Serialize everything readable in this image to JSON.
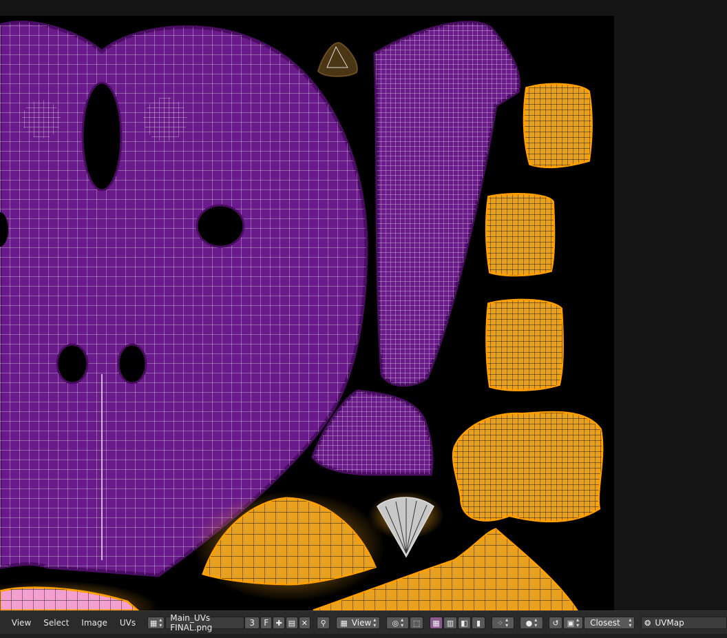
{
  "header": {
    "menus": [
      {
        "label": "View"
      },
      {
        "label": "Select"
      },
      {
        "label": "Image"
      },
      {
        "label": "UVs"
      }
    ],
    "image_name": "Main_UVs FINAL.png",
    "user_count": "3",
    "fake_user_label": "F",
    "view_dropdown_label": "View",
    "interpolation": "Closest",
    "uv_map": "UVMap"
  },
  "icons": {
    "image_browse": "image-icon",
    "new_image": "plus-icon",
    "open_image": "folder-icon",
    "unlink": "close-icon",
    "pin": "pin-icon",
    "mode": "view-mode-icon",
    "pivot": "pivot-icon",
    "sync": "sync-selection-icon",
    "select_mode": "select-mode-icons",
    "proportional": "proportional-edit-icon",
    "snap": "snap-icon",
    "uvmap": "uvmap-icon"
  },
  "colors": {
    "canvas_bg": "#000000",
    "island_purple": "#6a1a8a",
    "island_orange": "#e8a020",
    "header_bg": "#2b2b2b",
    "panel_bg": "#141414"
  }
}
